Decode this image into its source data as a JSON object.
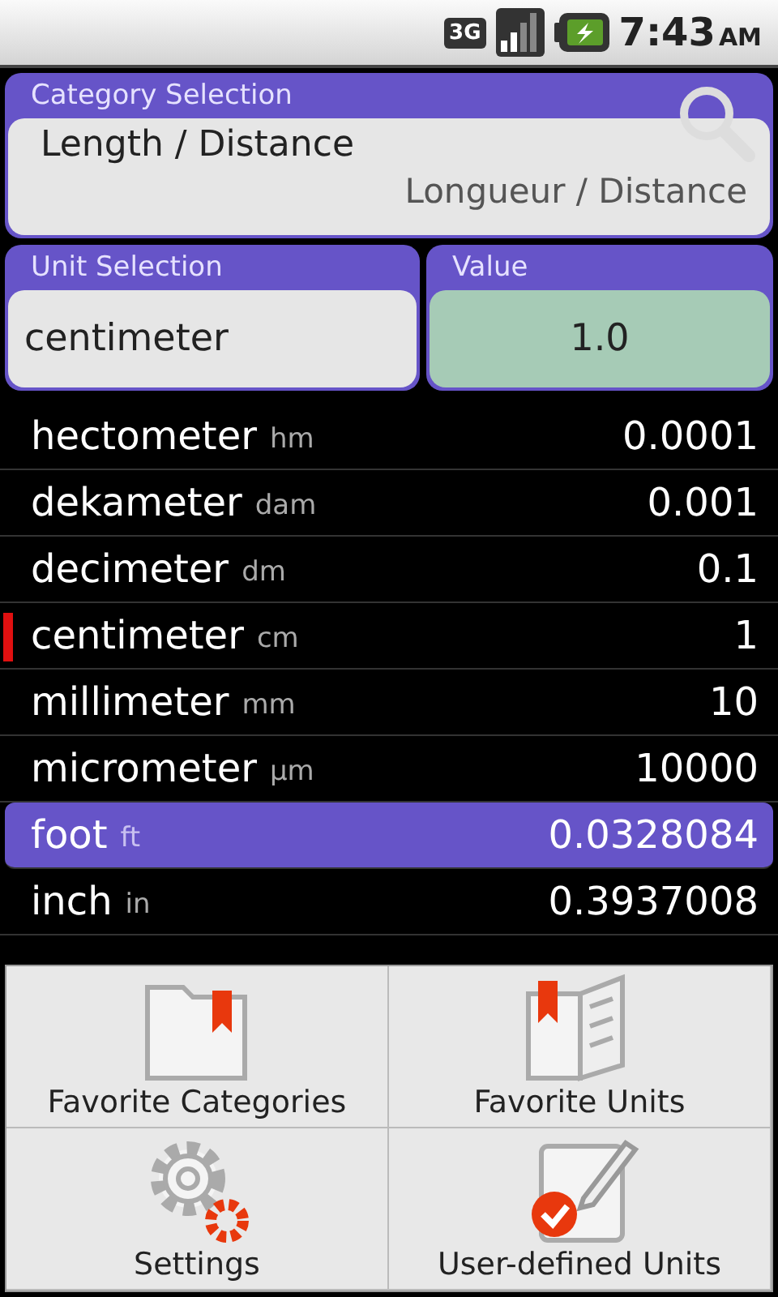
{
  "status_bar": {
    "network": "3G",
    "time": "7:43",
    "ampm": "AM"
  },
  "category": {
    "label": "Category  Selection",
    "value": "Length / Distance",
    "translation": "Longueur / Distance"
  },
  "unit": {
    "label": "Unit  Selection",
    "value": "centimeter"
  },
  "value": {
    "label": "Value",
    "value": "1.0"
  },
  "units": [
    {
      "name": "hectometer",
      "abbr": "hm",
      "value": "0.0001",
      "current": false,
      "selected": false
    },
    {
      "name": "dekameter",
      "abbr": "dam",
      "value": "0.001",
      "current": false,
      "selected": false
    },
    {
      "name": "decimeter",
      "abbr": "dm",
      "value": "0.1",
      "current": false,
      "selected": false
    },
    {
      "name": "centimeter",
      "abbr": "cm",
      "value": "1",
      "current": true,
      "selected": false
    },
    {
      "name": "millimeter",
      "abbr": "mm",
      "value": "10",
      "current": false,
      "selected": false
    },
    {
      "name": "micrometer",
      "abbr": "µm",
      "value": "10000",
      "current": false,
      "selected": false
    },
    {
      "name": "foot",
      "abbr": "ft",
      "value": "0.0328084",
      "current": false,
      "selected": true
    },
    {
      "name": "inch",
      "abbr": "in",
      "value": "0.3937008",
      "current": false,
      "selected": false
    }
  ],
  "menu": [
    {
      "label": "Favorite Categories",
      "kind": "folder"
    },
    {
      "label": "Favorite Units",
      "kind": "book"
    },
    {
      "label": "Settings",
      "kind": "gear"
    },
    {
      "label": "User-defined Units",
      "kind": "edit"
    }
  ]
}
